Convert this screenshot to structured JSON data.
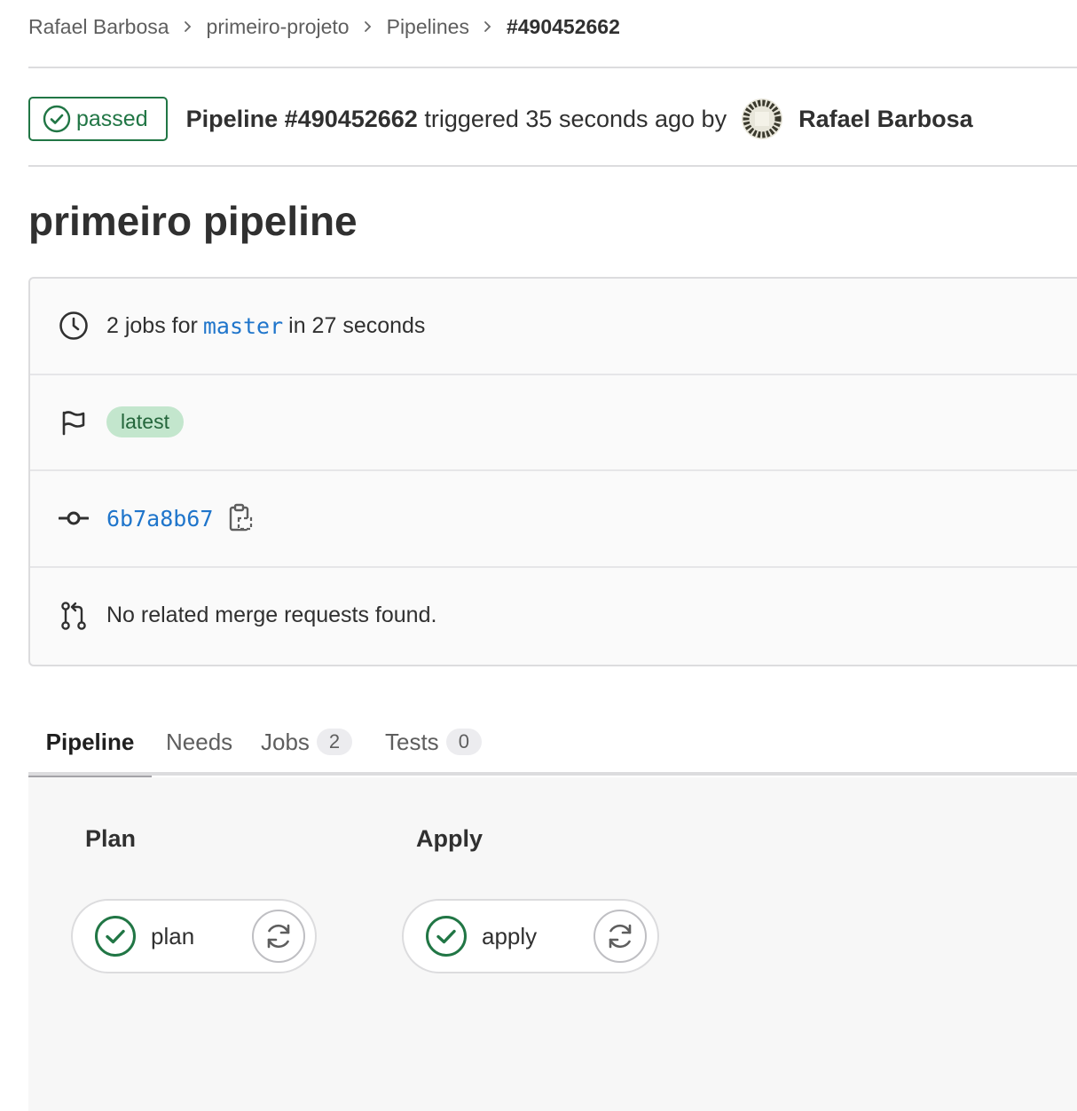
{
  "breadcrumb": {
    "items": [
      "Rafael Barbosa",
      "primeiro-projeto",
      "Pipelines",
      "#490452662"
    ]
  },
  "header": {
    "status_label": "passed",
    "pipeline_label": "Pipeline #490452662",
    "triggered_text": "triggered 35 seconds ago by",
    "author": "Rafael Barbosa"
  },
  "page_title": "primeiro pipeline",
  "info": {
    "jobs_prefix": "2 jobs for",
    "branch": "master",
    "jobs_suffix": "in 27 seconds",
    "tag": "latest",
    "commit_sha": "6b7a8b67",
    "merge_requests": "No related merge requests found."
  },
  "tabs": {
    "pipeline": "Pipeline",
    "needs": "Needs",
    "jobs": "Jobs",
    "jobs_count": "2",
    "tests": "Tests",
    "tests_count": "0"
  },
  "stages": [
    {
      "title": "Plan",
      "job": "plan"
    },
    {
      "title": "Apply",
      "job": "apply"
    }
  ],
  "colors": {
    "success": "#217645",
    "link": "#1f75cb",
    "tag_bg": "#c3e6cd"
  }
}
